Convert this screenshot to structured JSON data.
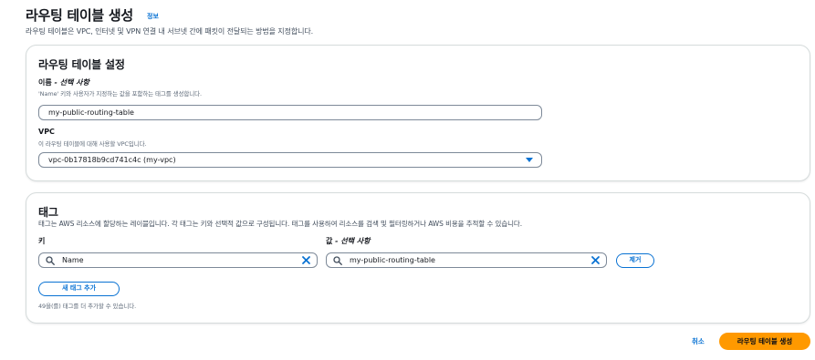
{
  "header": {
    "title": "라우팅 테이블 생성",
    "info": "정보",
    "description": "라우팅 테이블은 VPC, 인터넷 및 VPN 연결 내 서브넷 간에 패킷이 전달되는 방법을 지정합니다."
  },
  "settings": {
    "title": "라우팅 테이블 설정",
    "name_label": "이름",
    "name_optional": " - 선택 사항",
    "name_description": "'Name' 키와 사용자가 지정하는 값을 포함하는 태그를 생성합니다.",
    "name_value": "my-public-routing-table",
    "vpc_label": "VPC",
    "vpc_description": "이 라우팅 테이블에 대해 사용할 VPC입니다.",
    "vpc_value": "vpc-0b17818b9cd741c4c (my-vpc)"
  },
  "tags": {
    "title": "태그",
    "description": "태그는 AWS 리소스에 할당하는 레이블입니다. 각 태그는 키와 선택적 값으로 구성됩니다. 태그를 사용하여 리소스를 검색 및 필터링하거나 AWS 비용을 추적할 수 있습니다.",
    "key_label": "키",
    "value_label": "값",
    "value_optional": " - 선택 사항",
    "key_value": "Name",
    "value_value": "my-public-routing-table",
    "remove_label": "제거",
    "add_label": "새 태그 추가",
    "limit_text": "49을(를) 태그를 더 추가할 수 있습니다."
  },
  "footer": {
    "cancel": "취소",
    "submit": "라우팅 테이블 생성"
  },
  "colors": {
    "accent": "#0972d3",
    "primary_button": "#ff9900"
  },
  "icons": [
    "search-icon",
    "clear-icon",
    "dropdown-arrow-icon"
  ]
}
